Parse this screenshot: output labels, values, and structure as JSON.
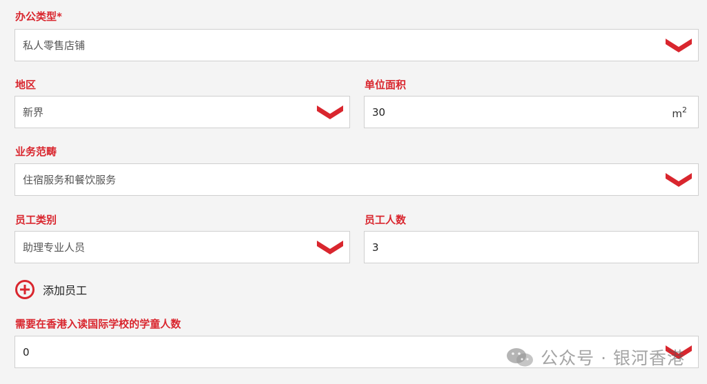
{
  "colors": {
    "accent": "#d9262e",
    "background": "#f4f4f4",
    "field_bg": "#ffffff"
  },
  "office_type": {
    "label": "办公类型*",
    "value": "私人零售店铺"
  },
  "district": {
    "label": "地区",
    "value": "新界"
  },
  "unit_area": {
    "label": "单位面积",
    "value": "30",
    "unit": "m",
    "unit_sup": "2"
  },
  "business_category": {
    "label": "业务范畴",
    "value": "住宿服务和餐饮服务"
  },
  "staff_type": {
    "label": "员工类别",
    "value": "助理专业人员"
  },
  "staff_count": {
    "label": "员工人数",
    "value": "3"
  },
  "add_staff": {
    "label": "添加员工"
  },
  "school_children": {
    "label": "需要在香港入读国际学校的学童人数",
    "value": "0"
  },
  "watermark": {
    "text": "公众号 · 银河香港"
  },
  "icons": {
    "dropdown": "chevron-down-icon",
    "add": "plus-circle-icon",
    "watermark": "wechat-icon"
  }
}
